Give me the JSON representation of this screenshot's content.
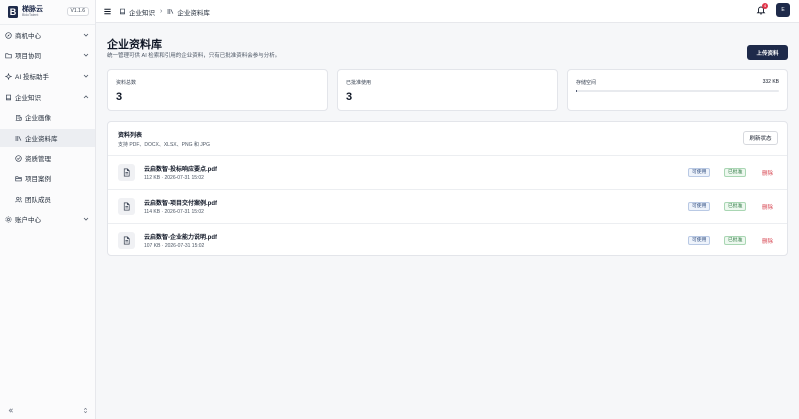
{
  "brand": {
    "name": "梯脉云",
    "subtitle": "BidoTalent",
    "version": "V1.1.6"
  },
  "sidebar": {
    "items": [
      {
        "label": "商机中心",
        "icon": "compass-icon",
        "expandable": true
      },
      {
        "label": "项目协同",
        "icon": "folder-icon",
        "expandable": true
      },
      {
        "label": "AI 投标助手",
        "icon": "sparkle-icon",
        "expandable": true
      },
      {
        "label": "企业知识",
        "icon": "book-icon",
        "expandable": true,
        "expanded": true
      },
      {
        "label": "企业画像",
        "icon": "building-icon",
        "sub": true
      },
      {
        "label": "企业资料库",
        "icon": "library-icon",
        "sub": true,
        "active": true
      },
      {
        "label": "资质管理",
        "icon": "badge-check-icon",
        "sub": true
      },
      {
        "label": "项目案例",
        "icon": "folder-open-icon",
        "sub": true
      },
      {
        "label": "团队成员",
        "icon": "users-icon",
        "sub": true
      },
      {
        "label": "账户中心",
        "icon": "settings-icon",
        "expandable": true
      }
    ]
  },
  "header": {
    "breadcrumb": [
      {
        "label": "企业知识"
      },
      {
        "label": "企业资料库"
      }
    ],
    "notification_count": "4",
    "avatar_initials": "E"
  },
  "page": {
    "title": "企业资料库",
    "description": "统一管理可供 AI 检索和引用的企业资料，只有已批准资料会参与分析。",
    "upload_label": "上传资料"
  },
  "stats": {
    "total_label": "资料总数",
    "total_value": "3",
    "approved_label": "已批准使用",
    "approved_value": "3",
    "storage_label": "存储空间",
    "storage_value": "332 KB",
    "storage_fraction": 0.001
  },
  "list": {
    "title": "资料列表",
    "subtitle": "支持 PDF、DOCX、XLSX、PNG 和 JPG",
    "refresh_label": "刷新状态",
    "rows": [
      {
        "name": "云启数智-投标响应要点.pdf",
        "meta": "112 KB · 2026-07-31 15:02",
        "status_available": "可使用",
        "status_approved": "已批准",
        "delete": "删除"
      },
      {
        "name": "云启数智-项目交付案例.pdf",
        "meta": "114 KB · 2026-07-31 15:02",
        "status_available": "可使用",
        "status_approved": "已批准",
        "delete": "删除"
      },
      {
        "name": "云启数智-企业能力说明.pdf",
        "meta": "107 KB · 2026-07-31 15:02",
        "status_available": "可使用",
        "status_approved": "已批准",
        "delete": "删除"
      }
    ]
  },
  "colors": {
    "brand": "#1e2a4a",
    "danger": "#d6434f",
    "success": "#2f7a43",
    "info": "#2c4a7e"
  }
}
